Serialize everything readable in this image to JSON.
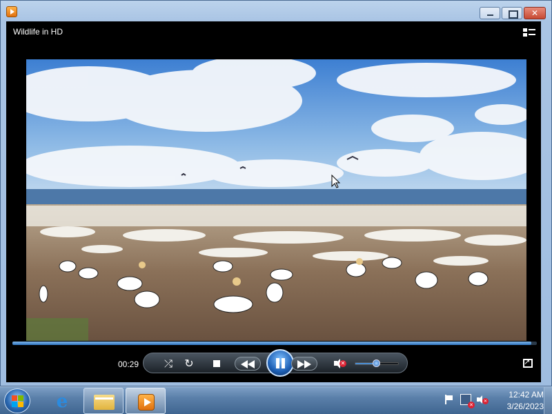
{
  "window": {
    "app_icon": "windows-media-player-icon",
    "buttons": [
      "minimize",
      "maximize",
      "close"
    ]
  },
  "player": {
    "title": "Wildlife in HD",
    "elapsed_time": "00:29",
    "progress_fraction": 0.99,
    "volume_fraction": 0.5,
    "muted": true,
    "state": "playing",
    "controls": [
      "shuffle",
      "repeat",
      "stop",
      "previous",
      "pause",
      "next",
      "mute",
      "volume",
      "full-screen"
    ],
    "video_scene": "gannet-colony-on-coastal-headland"
  },
  "taskbar": {
    "start": "start-icon",
    "items": [
      {
        "name": "internet-explorer",
        "icon": "internet-explorer-icon"
      },
      {
        "name": "windows-explorer",
        "icon": "folder-icon"
      },
      {
        "name": "windows-media-player",
        "icon": "windows-media-player-icon",
        "active": true
      }
    ],
    "tray": [
      "action-center-flag-icon",
      "network-disconnected-icon",
      "volume-muted-icon"
    ],
    "clock": {
      "time": "12:42 AM",
      "date": "3/26/2023"
    }
  },
  "colors": {
    "accent": "#2f74c0",
    "mute_badge": "#dd2233",
    "taskbar": "#5a7fa9"
  }
}
